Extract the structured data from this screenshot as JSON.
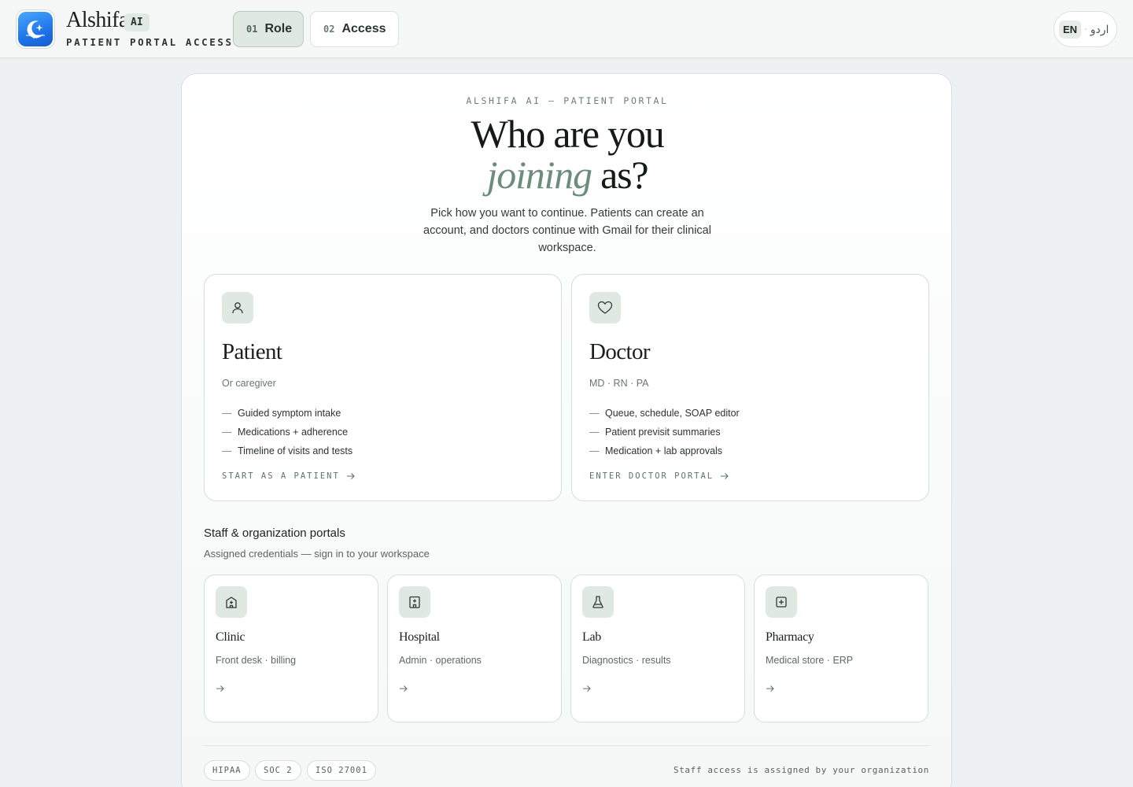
{
  "header": {
    "brand_name": "Alshifa",
    "brand_badge": "AI",
    "brand_subtitle": "PATIENT PORTAL ACCESS",
    "steps": [
      {
        "num": "01",
        "label": "Role"
      },
      {
        "num": "02",
        "label": "Access"
      }
    ],
    "language": {
      "active": "EN",
      "separator": "·",
      "alternate": "اردو"
    }
  },
  "hero": {
    "eyebrow": "ALSHIFA AI — PATIENT PORTAL",
    "headline_line1": "Who are you",
    "headline_accent": "joining",
    "headline_end": "as?",
    "lead": "Pick how you want to continue. Patients can create an account, and doctors continue with Gmail for their clinical workspace."
  },
  "roles": {
    "patient": {
      "icon": "person-icon",
      "title": "Patient",
      "subtitle": "Or caregiver",
      "features": [
        "Guided symptom intake",
        "Medications + adherence",
        "Timeline of visits and tests"
      ],
      "cta": "START AS A PATIENT"
    },
    "doctor": {
      "icon": "heart-icon",
      "title": "Doctor",
      "subtitle": "MD · RN · PA",
      "features": [
        "Queue, schedule, SOAP editor",
        "Patient previsit summaries",
        "Medication + lab approvals"
      ],
      "cta": "ENTER DOCTOR PORTAL"
    }
  },
  "staff": {
    "title": "Staff & organization portals",
    "subtitle": "Assigned credentials — sign in to your workspace",
    "portals": [
      {
        "icon": "clinic-icon",
        "title": "Clinic",
        "subtitle": "Front desk · billing"
      },
      {
        "icon": "hospital-icon",
        "title": "Hospital",
        "subtitle": "Admin · operations"
      },
      {
        "icon": "flask-icon",
        "title": "Lab",
        "subtitle": "Diagnostics · results"
      },
      {
        "icon": "pharmacy-icon",
        "title": "Pharmacy",
        "subtitle": "Medical store · ERP"
      }
    ]
  },
  "footer": {
    "badges": [
      "HIPAA",
      "SOC 2",
      "ISO 27001"
    ],
    "note": "Staff access is assigned by your organization"
  },
  "colors": {
    "accent": "#6e8c7b",
    "accent_soft": "#dfe8e2",
    "logo_blue": "#1f74e8",
    "background": "#eef1f1"
  }
}
